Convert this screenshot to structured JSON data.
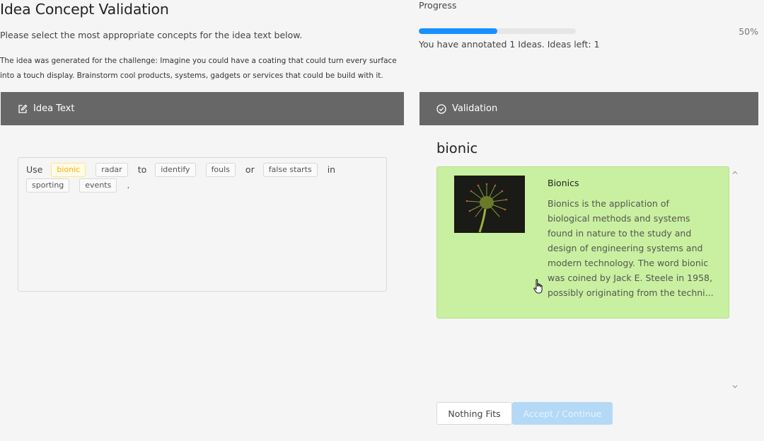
{
  "header": {
    "title": "Idea Concept Validation",
    "subtitle": "Please select the most appropriate concepts for the idea text below.",
    "challenge": "The idea was generated for the challenge: Imagine you could have a coating that could turn every surface into a touch display. Brainstorm cool products, systems, gadgets or services that could be build with it."
  },
  "progress": {
    "label": "Progress",
    "percent_text": "50%",
    "fraction": 0.5,
    "status": "You have annotated 1 Ideas. Ideas left: 1",
    "bar_color": "#1890ff"
  },
  "idea_panel": {
    "title": "Idea Text",
    "icon": "edit-icon",
    "tokens": [
      {
        "text": "Use",
        "tag": false
      },
      {
        "text": "bionic",
        "tag": true,
        "selected": true
      },
      {
        "text": "radar",
        "tag": true
      },
      {
        "text": "to",
        "tag": false
      },
      {
        "text": "identify",
        "tag": true
      },
      {
        "text": "fouls",
        "tag": true
      },
      {
        "text": "or",
        "tag": false
      },
      {
        "text": "false starts",
        "tag": true
      },
      {
        "text": "in",
        "tag": false
      },
      {
        "text": "sporting",
        "tag": true
      },
      {
        "text": "events",
        "tag": true
      },
      {
        "text": ".",
        "tag": false
      }
    ]
  },
  "validation_panel": {
    "title": "Validation",
    "icon": "check-circle-icon",
    "concept_word": "bionic",
    "card": {
      "title": "Bionics",
      "description": "Bionics is the application of biological methods and systems found in nature to the study and design of engineering systems and modern technology. The word bionic was coined by Jack E. Steele in 1958, possibly originating from the techni...",
      "bg_color": "#c9f0a0"
    }
  },
  "buttons": {
    "nothing_fits": "Nothing Fits",
    "accept": "Accept / Continue"
  }
}
